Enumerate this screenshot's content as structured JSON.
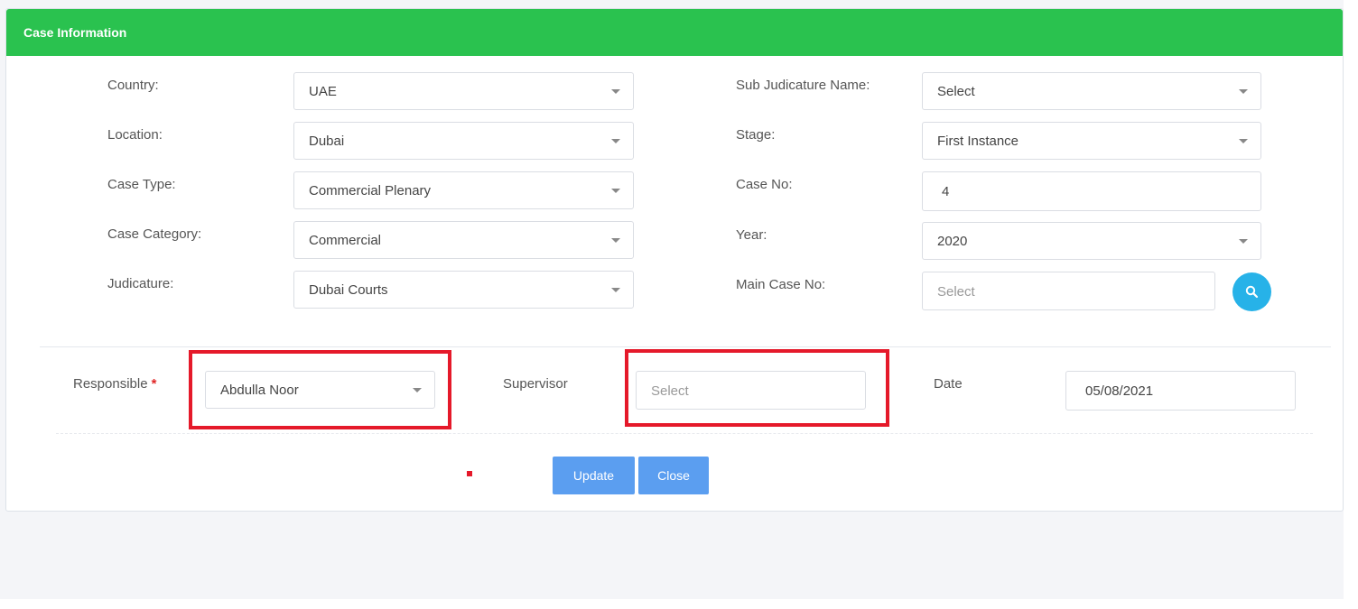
{
  "panel": {
    "title": "Case Information"
  },
  "left_fields": [
    {
      "label": "Country:",
      "value": "UAE"
    },
    {
      "label": "Location:",
      "value": "Dubai"
    },
    {
      "label": "Case Type:",
      "value": "Commercial Plenary"
    },
    {
      "label": "Case Category:",
      "value": "Commercial"
    },
    {
      "label": "Judicature:",
      "value": "Dubai Courts"
    }
  ],
  "right_fields": {
    "sub_judicature": {
      "label": "Sub Judicature Name:",
      "value": "Select"
    },
    "stage": {
      "label": "Stage:",
      "value": "First Instance"
    },
    "case_no": {
      "label": "Case No:",
      "value": "4"
    },
    "year": {
      "label": "Year:",
      "value": "2020"
    },
    "main_case_no": {
      "label": "Main Case No:",
      "placeholder": "Select",
      "search_icon": "search-icon"
    }
  },
  "assignment": {
    "responsible": {
      "label": "Responsible",
      "required_mark": "*",
      "value": "Abdulla Noor"
    },
    "supervisor": {
      "label": "Supervisor",
      "placeholder": "Select"
    },
    "date": {
      "label": "Date",
      "value": "05/08/2021"
    }
  },
  "actions": {
    "update_label": "Update",
    "close_label": "Close"
  },
  "colors": {
    "header": "#2ac24f",
    "search_button": "#27b2e8",
    "action_button": "#5b9ef0",
    "highlight": "#e5192a",
    "required": "#e02424"
  }
}
